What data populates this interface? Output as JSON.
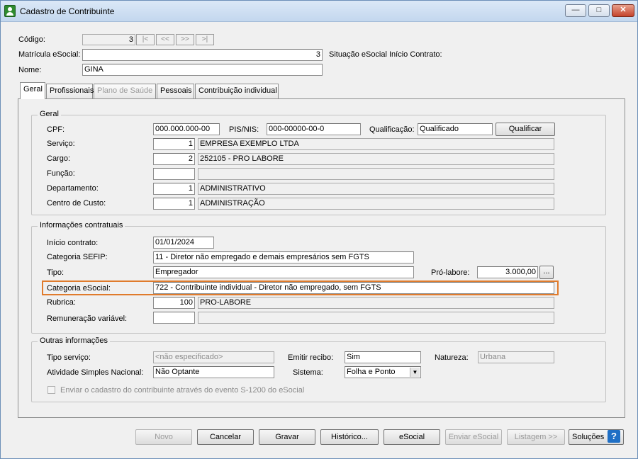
{
  "window": {
    "title": "Cadastro de Contribuinte"
  },
  "header": {
    "codigo_label": "Código:",
    "codigo_value": "3",
    "nav": [
      "|<",
      "<<",
      ">>",
      ">|"
    ],
    "matricula_label": "Matrícula eSocial:",
    "matricula_value": "3",
    "situacao_label": "Situação eSocial Início Contrato:",
    "nome_label": "Nome:",
    "nome_value": "GINA"
  },
  "tabs": [
    "Geral",
    "Profissionais",
    "Plano de Saúde",
    "Pessoais",
    "Contribuição individual"
  ],
  "geral": {
    "group_label": "Geral",
    "cpf_label": "CPF:",
    "cpf_value": "000.000.000-00",
    "pis_label": "PIS/NIS:",
    "pis_value": "000-00000-00-0",
    "qualificacao_label": "Qualificação:",
    "qualificacao_value": "Qualificado",
    "qualificar_button": "Qualificar",
    "servico_label": "Serviço:",
    "servico_code": "1",
    "servico_desc": "EMPRESA EXEMPLO LTDA",
    "cargo_label": "Cargo:",
    "cargo_code": "2",
    "cargo_desc": "252105 - PRO LABORE",
    "funcao_label": "Função:",
    "funcao_code": "",
    "funcao_desc": "",
    "departamento_label": "Departamento:",
    "departamento_code": "1",
    "departamento_desc": "ADMINISTRATIVO",
    "centro_label": "Centro de Custo:",
    "centro_code": "1",
    "centro_desc": "ADMINISTRAÇÃO"
  },
  "contratuais": {
    "group_label": "Informações contratuais",
    "inicio_label": "Início contrato:",
    "inicio_value": "01/01/2024",
    "sefip_label": "Categoria SEFIP:",
    "sefip_value": "11 - Diretor não empregado e demais empresários sem FGTS",
    "tipo_label": "Tipo:",
    "tipo_value": "Empregador",
    "prolabore_label": "Pró-labore:",
    "prolabore_value": "3.000,00",
    "prolabore_btn": "...",
    "esocial_label": "Categoria eSocial:",
    "esocial_value": "722 - Contribuinte individual - Diretor não empregado, sem FGTS",
    "rubrica_label": "Rubrica:",
    "rubrica_code": "100",
    "rubrica_desc": "PRO-LABORE",
    "remuneracao_label": "Remuneração variável:",
    "remuneracao_code": "",
    "remuneracao_desc": ""
  },
  "outras": {
    "group_label": "Outras informações",
    "tipo_servico_label": "Tipo serviço:",
    "tipo_servico_value": "<não especificado>",
    "emitir_label": "Emitir recibo:",
    "emitir_value": "Sim",
    "natureza_label": "Natureza:",
    "natureza_value": "Urbana",
    "atividade_label": "Atividade Simples Nacional:",
    "atividade_value": "Não Optante",
    "sistema_label": "Sistema:",
    "sistema_value": "Folha e Ponto",
    "enviar_label": "Enviar o cadastro do contribuinte através do evento S-1200 do eSocial"
  },
  "footer": {
    "novo": "Novo",
    "cancelar": "Cancelar",
    "gravar": "Gravar",
    "historico": "Histórico...",
    "esocial": "eSocial",
    "enviar_esocial": "Enviar eSocial",
    "listagem": "Listagem >>",
    "solucoes": "Soluções",
    "help": "?"
  },
  "colors": {
    "highlight": "#e07b2c",
    "help_icon": "#1f6fc5",
    "app_icon": "#2e8b2e"
  }
}
